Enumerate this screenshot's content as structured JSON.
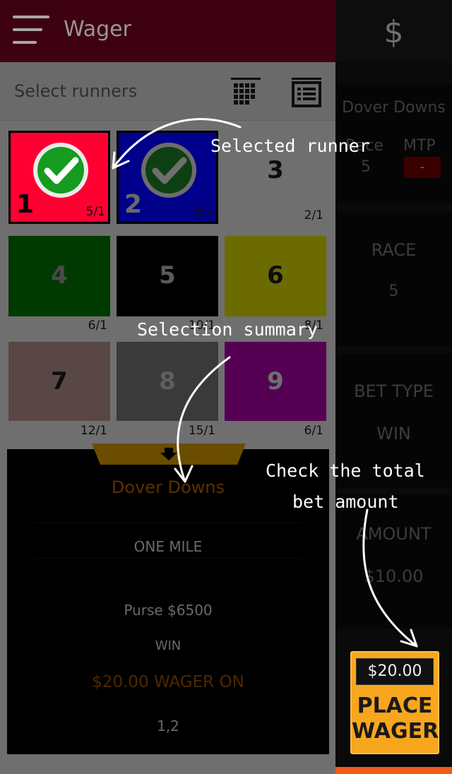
{
  "header": {
    "title": "Wager"
  },
  "subheader": {
    "label": "Select runners"
  },
  "runners": [
    {
      "number": "1",
      "odds": "5/1",
      "color": "#ff0033",
      "selected": true
    },
    {
      "number": "2",
      "odds": "6/1",
      "color": "#00008b",
      "selected": true
    },
    {
      "number": "3",
      "odds": "2/1",
      "color": "#6f6f6f",
      "selected": false
    },
    {
      "number": "4",
      "odds": "6/1",
      "color": "#013a01",
      "selected": false
    },
    {
      "number": "5",
      "odds": "10/1",
      "color": "#000000",
      "selected": false
    },
    {
      "number": "6",
      "odds": "8/1",
      "color": "#6b6b00",
      "selected": false
    },
    {
      "number": "7",
      "odds": "12/1",
      "color": "#584745",
      "selected": false
    },
    {
      "number": "8",
      "odds": "15/1",
      "color": "#3a3a3a",
      "selected": false
    },
    {
      "number": "9",
      "odds": "6/1",
      "color": "#560054",
      "selected": false
    }
  ],
  "summary": {
    "track": "Dover Downs",
    "distance": "ONE MILE",
    "purse": "Purse $6500",
    "bet_type": "WIN",
    "wager": "$20.00 WAGER ON",
    "selections": "1,2"
  },
  "sidebar": {
    "track": "Dover Downs",
    "race_label": "Race",
    "race_value": "5",
    "mtp_label": "MTP",
    "mtp_value": "-",
    "race_section_label": "RACE",
    "race_section_value": "5",
    "bet_type_label": "BET TYPE",
    "bet_type_value": "WIN",
    "amount_label": "AMOUNT",
    "amount_value": "$10.00"
  },
  "place_wager": {
    "amount": "$20.00",
    "label_line1": "PLACE",
    "label_line2": "WAGER"
  },
  "annotations": {
    "selected_runner": "Selected runner",
    "selection_summary": "Selection summary",
    "check_total_line1": "Check the total",
    "check_total_line2": "bet amount"
  },
  "colors": {
    "header": "#3e0112",
    "accent": "#f8a61d",
    "mtp": "#3a0000"
  }
}
